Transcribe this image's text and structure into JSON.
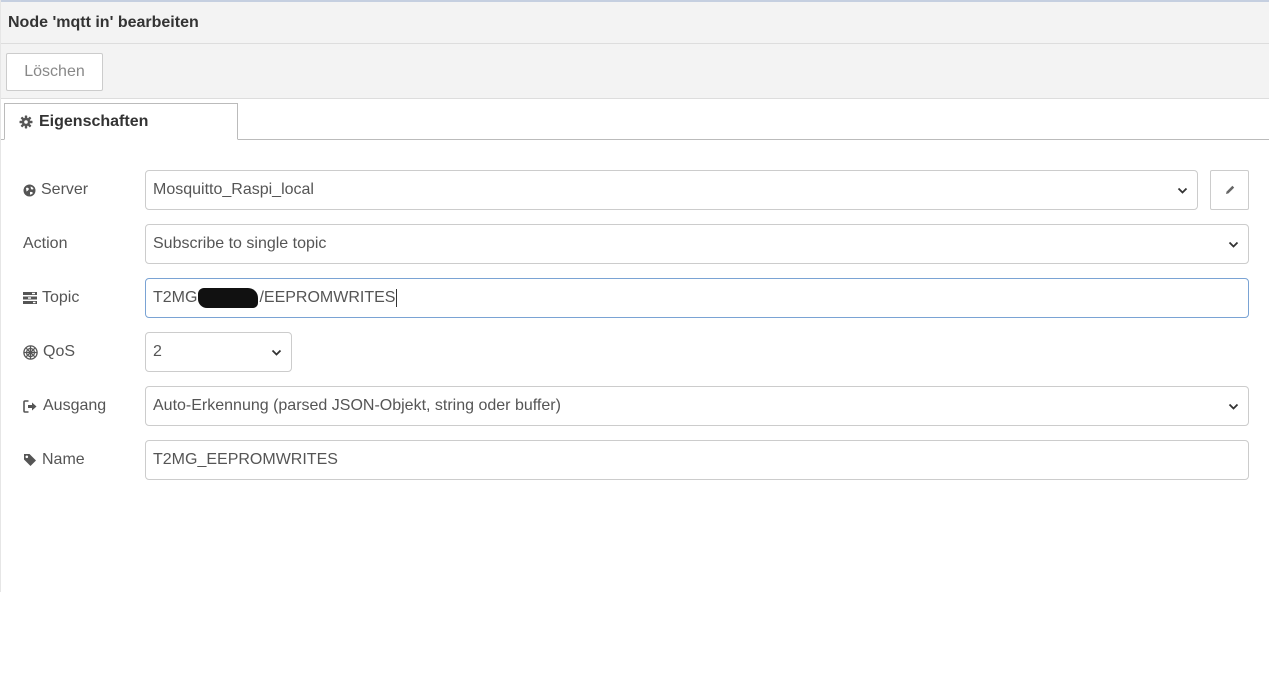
{
  "header": {
    "title": "Node 'mqtt in' bearbeiten"
  },
  "toolbar": {
    "delete_label": "Löschen"
  },
  "tabs": [
    {
      "label": "Eigenschaften",
      "icon": "cog-icon"
    }
  ],
  "form": {
    "server": {
      "label": "Server",
      "icon": "globe-icon",
      "value": "Mosquitto_Raspi_local"
    },
    "action": {
      "label": "Action",
      "value": "Subscribe to single topic"
    },
    "topic": {
      "label": "Topic",
      "icon": "tasks-icon",
      "value_prefix": "T2MG",
      "value_suffix": "/EEPROMWRITES"
    },
    "qos": {
      "label": "QoS",
      "icon": "empire-icon",
      "value": "2"
    },
    "output": {
      "label": "Ausgang",
      "icon": "sign-out-icon",
      "value": "Auto-Erkennung (parsed JSON-Objekt, string oder buffer)"
    },
    "name": {
      "label": "Name",
      "icon": "tag-icon",
      "value": "T2MG_EEPROMWRITES"
    }
  },
  "colors": {
    "focus_border": "#7aa3d4",
    "panel_bg": "#f3f3f3",
    "text": "#555555"
  }
}
